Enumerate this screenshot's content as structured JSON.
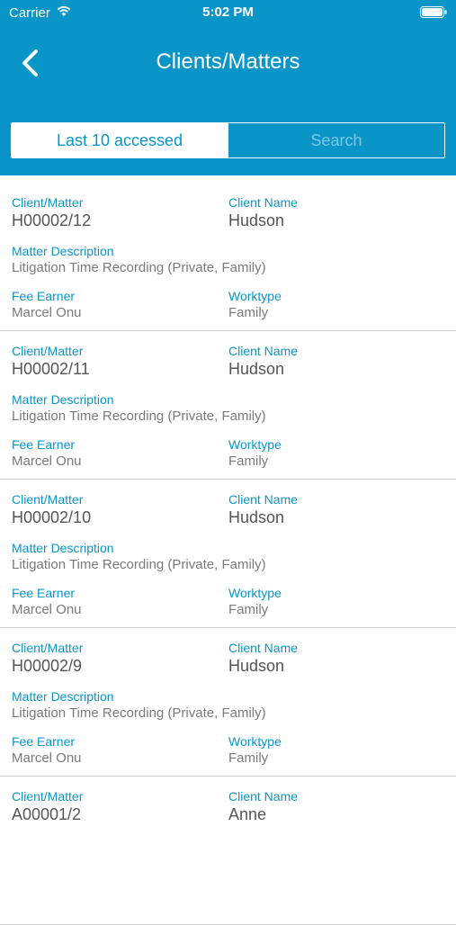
{
  "status_bar": {
    "carrier": "Carrier",
    "time": "5:02 PM"
  },
  "header": {
    "title": "Clients/Matters",
    "back_icon": "chevron-left-icon"
  },
  "tabs": {
    "recent": "Last 10 accessed",
    "search": "Search",
    "active": "recent"
  },
  "labels": {
    "client_matter": "Client/Matter",
    "client_name": "Client Name",
    "matter_description": "Matter Description",
    "fee_earner": "Fee Earner",
    "worktype": "Worktype"
  },
  "items": [
    {
      "client_matter": "H00002/12",
      "client_name": "Hudson",
      "matter_description": "Litigation Time Recording (Private, Family)",
      "fee_earner": "Marcel Onu",
      "worktype": "Family"
    },
    {
      "client_matter": "H00002/11",
      "client_name": "Hudson",
      "matter_description": "Litigation Time Recording (Private, Family)",
      "fee_earner": "Marcel Onu",
      "worktype": "Family"
    },
    {
      "client_matter": "H00002/10",
      "client_name": "Hudson",
      "matter_description": "Litigation Time Recording (Private, Family)",
      "fee_earner": "Marcel Onu",
      "worktype": "Family"
    },
    {
      "client_matter": "H00002/9",
      "client_name": "Hudson",
      "matter_description": "Litigation Time Recording (Private, Family)",
      "fee_earner": "Marcel Onu",
      "worktype": "Family"
    },
    {
      "client_matter": "A00001/2",
      "client_name": "Anne",
      "matter_description": "",
      "fee_earner": "",
      "worktype": ""
    }
  ],
  "colors": {
    "brand": "#0a95c9",
    "label": "#0a95c9",
    "divider": "#d0d0d0"
  }
}
